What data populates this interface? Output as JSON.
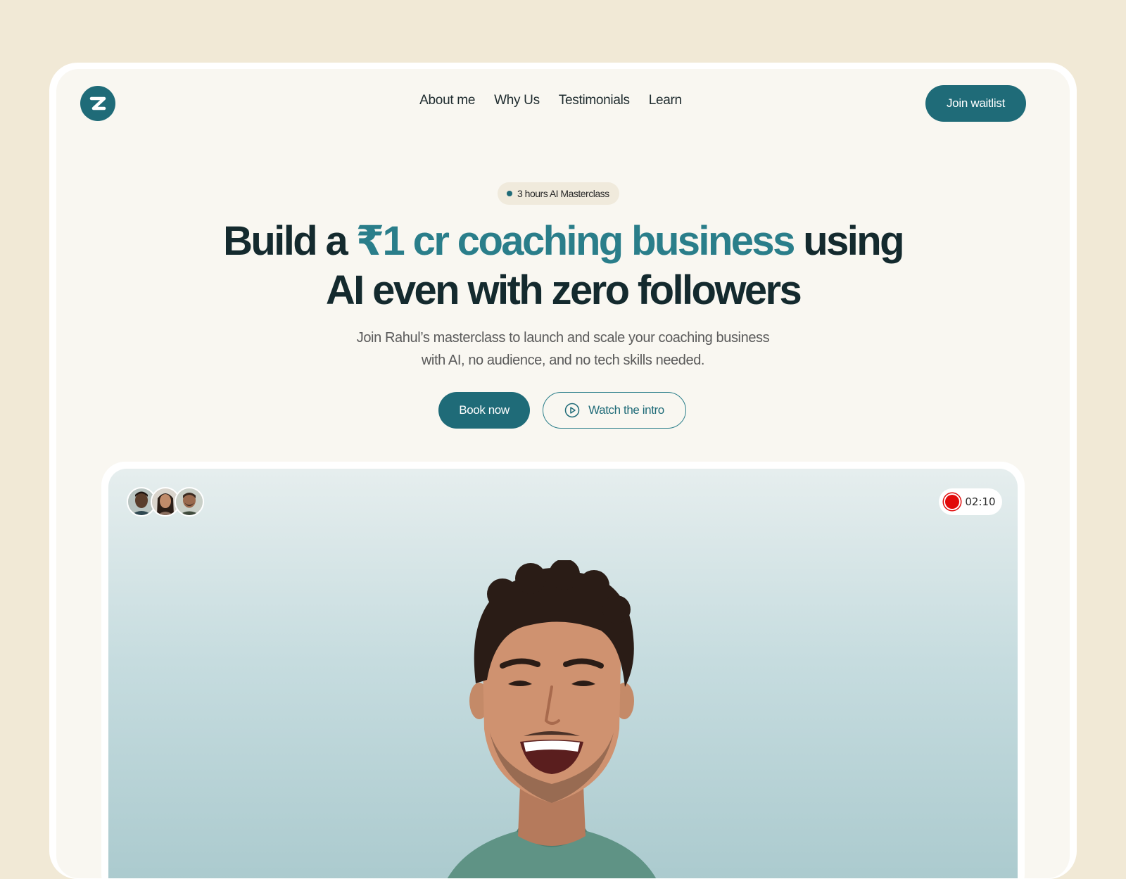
{
  "brand": {
    "logo_letter": "z",
    "accent": "#1f6b78",
    "highlight": "#2a7e8a"
  },
  "nav": {
    "items": [
      "About me",
      "Why Us",
      "Testimonials",
      "Learn"
    ]
  },
  "header": {
    "cta_label": "Join waitlist"
  },
  "hero": {
    "pill": "3 hours AI Masterclass",
    "headline_pre": "Build a ",
    "headline_highlight": "₹1 cr coaching business",
    "headline_post_1": " using",
    "headline_line2": "AI even with zero followers",
    "sub_line1": "Join Rahul’s masterclass to launch and scale your coaching business",
    "sub_line2": "with AI, no audience, and no tech skills needed.",
    "book_label": "Book now",
    "intro_label": "Watch the intro"
  },
  "video": {
    "timer": "02:10",
    "recording_color": "#e10b0b",
    "participants": [
      "avatar-1",
      "avatar-2",
      "avatar-3"
    ]
  }
}
